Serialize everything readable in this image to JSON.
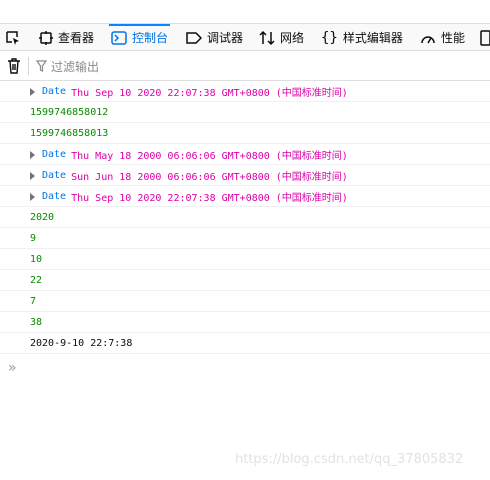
{
  "toolbar": {
    "tabs": [
      {
        "label": "查看器",
        "icon": "inspector-icon"
      },
      {
        "label": "控制台",
        "icon": "console-icon",
        "selected": true
      },
      {
        "label": "调试器",
        "icon": "debugger-icon"
      },
      {
        "label": "网络",
        "icon": "network-icon"
      },
      {
        "label": "样式编辑器",
        "icon": "style-editor-icon"
      },
      {
        "label": "性能",
        "icon": "performance-icon"
      }
    ]
  },
  "filter": {
    "placeholder": "过滤输出"
  },
  "messages": [
    {
      "kind": "date",
      "type": "Date",
      "value": "Thu Sep 10 2020 22:07:38 GMT+0800 (中国标准时间)"
    },
    {
      "kind": "number",
      "value": "1599746858012"
    },
    {
      "kind": "number",
      "value": "1599746858013"
    },
    {
      "kind": "date",
      "type": "Date",
      "value": "Thu May 18 2000 06:06:06 GMT+0800 (中国标准时间)"
    },
    {
      "kind": "date",
      "type": "Date",
      "value": "Sun Jun 18 2000 06:06:06 GMT+0800 (中国标准时间)"
    },
    {
      "kind": "date",
      "type": "Date",
      "value": "Thu Sep 10 2020 22:07:38 GMT+0800 (中国标准时间)"
    },
    {
      "kind": "number",
      "value": "2020"
    },
    {
      "kind": "number",
      "value": "9"
    },
    {
      "kind": "number",
      "value": "10"
    },
    {
      "kind": "number",
      "value": "22"
    },
    {
      "kind": "number",
      "value": "7"
    },
    {
      "kind": "number",
      "value": "38"
    },
    {
      "kind": "string",
      "value": "2020-9-10 22:7:38"
    }
  ],
  "prompt": "»",
  "watermark": "https://blog.csdn.net/qq_37805832"
}
